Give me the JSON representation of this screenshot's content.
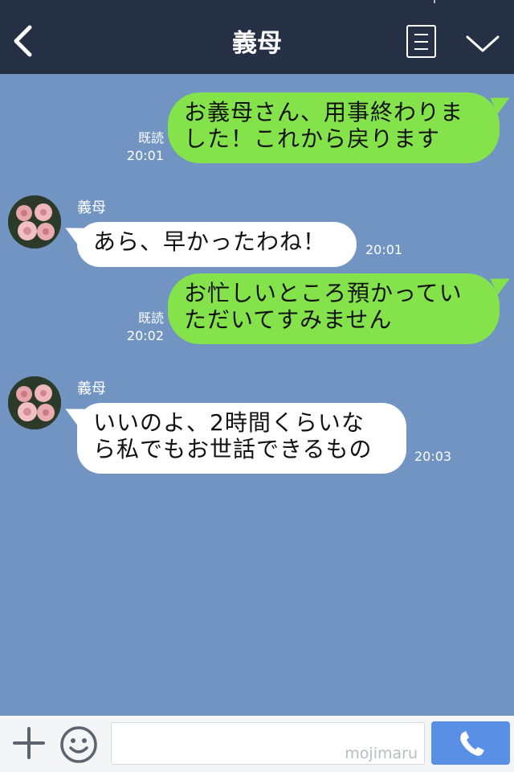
{
  "header": {
    "title": "義母"
  },
  "messages": [
    {
      "side": "out",
      "lines": [
        "お義母さん、用事終わりま",
        "した！これから戻ります"
      ],
      "read": "既読",
      "time": "20:01"
    },
    {
      "side": "in",
      "sender": "義母",
      "lines": [
        "あら、早かったわね！"
      ],
      "time": "20:01"
    },
    {
      "side": "out",
      "lines": [
        "お忙しいところ預かってい",
        "ただいてすみません"
      ],
      "read": "既読",
      "time": "20:02"
    },
    {
      "side": "in",
      "sender": "義母",
      "lines": [
        "いいのよ、2時間くらいな",
        "ら私でもお世話できるもの"
      ],
      "time": "20:03"
    }
  ],
  "input": {
    "watermark": "mojimaru"
  },
  "icons": {
    "back": "chevron-left-icon",
    "menu": "menu-list-icon",
    "collapse": "chevron-down-icon",
    "add": "plus-icon",
    "emoji": "smiley-icon",
    "call": "phone-icon"
  },
  "colors": {
    "header_bg": "#253045",
    "chat_bg": "#7194c2",
    "outgoing_bubble": "#84e34a",
    "incoming_bubble": "#ffffff",
    "call_button": "#5a8fe6"
  }
}
